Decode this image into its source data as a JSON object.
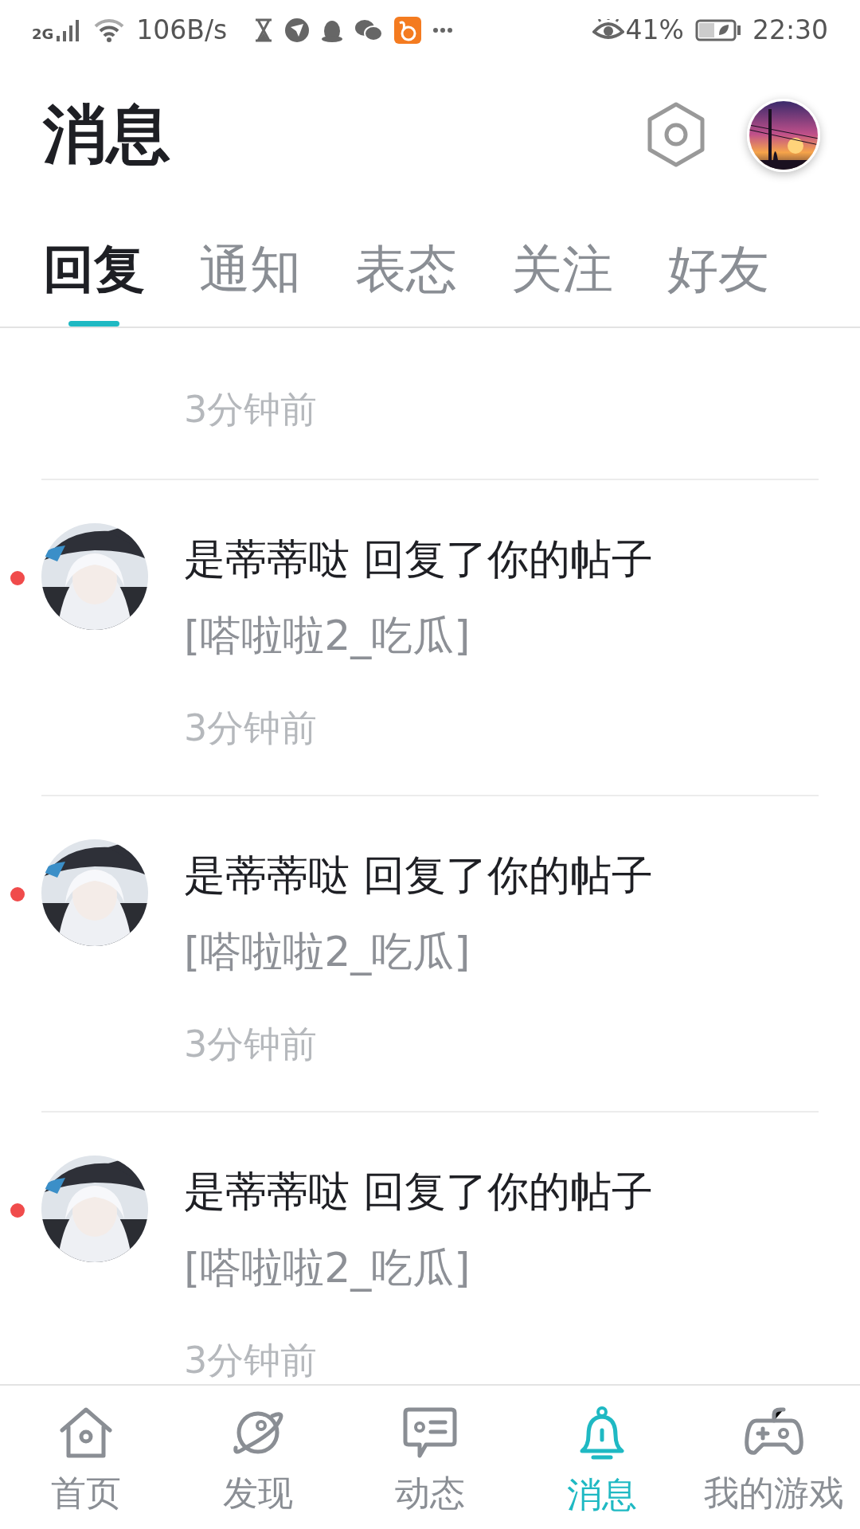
{
  "status_bar": {
    "network": "2G",
    "speed": "106B/s",
    "battery": "41%",
    "time": "22:30"
  },
  "header": {
    "title": "消息"
  },
  "tabs": [
    {
      "label": "回复",
      "selected": true
    },
    {
      "label": "通知",
      "selected": false
    },
    {
      "label": "表态",
      "selected": false
    },
    {
      "label": "关注",
      "selected": false
    },
    {
      "label": "好友",
      "selected": false
    }
  ],
  "messages": [
    {
      "kind": "partial",
      "time": "3分钟前"
    },
    {
      "kind": "full",
      "unread": true,
      "title": "是蒂蒂哒 回复了你的帖子",
      "preview": "[嗒啦啦2_吃瓜]",
      "time": "3分钟前"
    },
    {
      "kind": "full",
      "unread": true,
      "title": "是蒂蒂哒 回复了你的帖子",
      "preview": "[嗒啦啦2_吃瓜]",
      "time": "3分钟前"
    },
    {
      "kind": "full",
      "unread": true,
      "title": "是蒂蒂哒 回复了你的帖子",
      "preview": "[嗒啦啦2_吃瓜]",
      "time": "3分钟前"
    }
  ],
  "bottom_nav": [
    {
      "label": "首页",
      "selected": false
    },
    {
      "label": "发现",
      "selected": false
    },
    {
      "label": "动态",
      "selected": false
    },
    {
      "label": "消息",
      "selected": true
    },
    {
      "label": "我的游戏",
      "selected": false
    }
  ]
}
